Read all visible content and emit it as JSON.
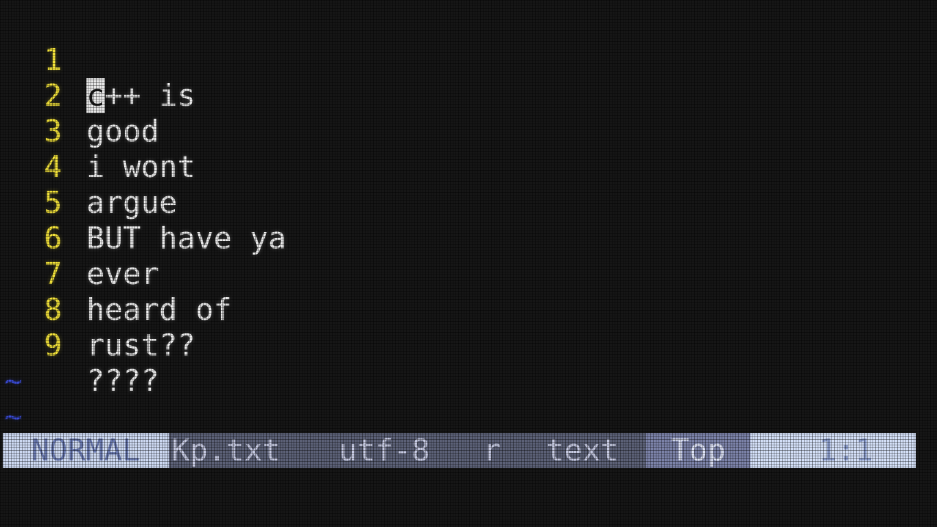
{
  "editor": {
    "lines": [
      {
        "num": "1",
        "cursor_char": "c",
        "rest": "++ is"
      },
      {
        "num": "2",
        "text": "good"
      },
      {
        "num": "3",
        "text": "i wont"
      },
      {
        "num": "4",
        "text": "argue"
      },
      {
        "num": "5",
        "text": "BUT have ya"
      },
      {
        "num": "6",
        "text": "ever"
      },
      {
        "num": "7",
        "text": "heard of"
      },
      {
        "num": "8",
        "text": "rust??"
      },
      {
        "num": "9",
        "text": "????"
      }
    ],
    "tildes": [
      "~",
      "~",
      "~"
    ]
  },
  "statusline": {
    "mode": "NORMAL",
    "filename": "Kp.txt",
    "encoding": "utf-8",
    "fileformat": "r",
    "filetype": "text",
    "position_pct": "Top",
    "cursor": "1:1"
  },
  "colors": {
    "line_number": "#f2e23a",
    "tilde": "#3a4bd6",
    "mode_bg": "#cdd9f2",
    "statusline_bg": "#5c6177"
  }
}
